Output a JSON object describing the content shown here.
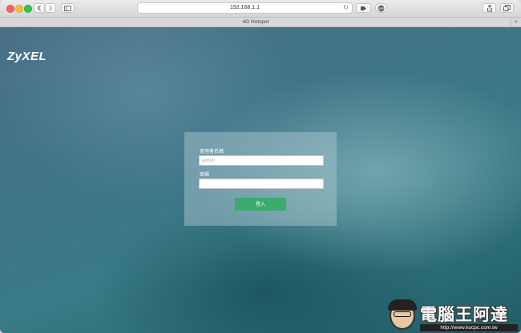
{
  "browser": {
    "url": "192.168.1.1",
    "tab_title": "4G Hotspot",
    "back_icon": "chevron-left-icon",
    "forward_icon": "chevron-right-icon",
    "sidebar_icon": "sidebar-icon",
    "reload_icon": "reload-icon",
    "share_icon": "share-icon",
    "tabs_icon": "tabs-overview-icon",
    "new_tab_label": "+"
  },
  "page": {
    "brand": "ZyXEL",
    "username_label": "使用者名稱",
    "username_placeholder": "admin",
    "password_label": "密碼",
    "password_value": "",
    "login_button": "登入"
  },
  "watermark": {
    "title": "電腦王阿達",
    "url": "http://www.kocpc.com.tw"
  },
  "colors": {
    "button": "#3aaa6d",
    "panel": "rgba(180,205,212,0.45)",
    "background": "#3f7487"
  }
}
